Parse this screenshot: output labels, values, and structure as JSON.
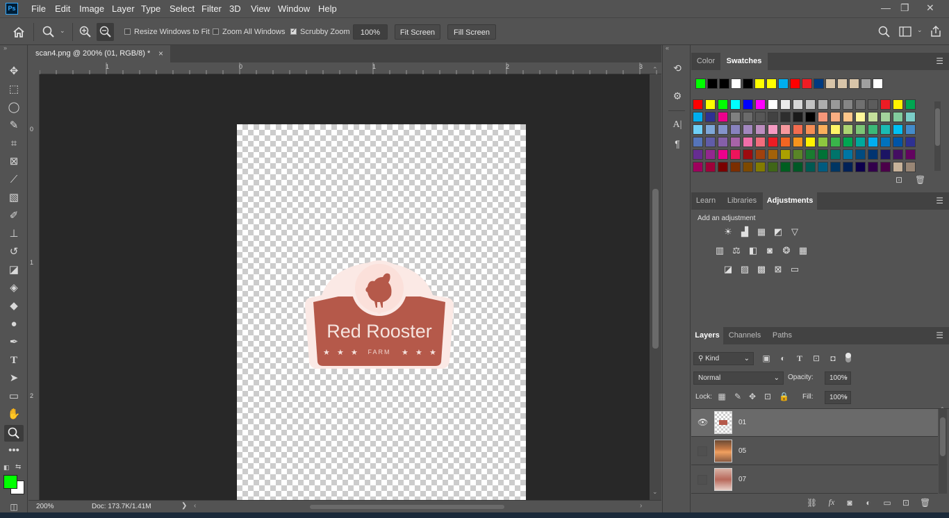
{
  "app": {
    "logo_text": "Ps"
  },
  "menu": [
    "File",
    "Edit",
    "Image",
    "Layer",
    "Type",
    "Select",
    "Filter",
    "3D",
    "View",
    "Window",
    "Help"
  ],
  "window_controls": {
    "minimize": "—",
    "restore": "❐",
    "close": "✕"
  },
  "options_bar": {
    "resize_windows_label": "Resize Windows to Fit",
    "resize_windows_checked": false,
    "zoom_all_label": "Zoom All Windows",
    "zoom_all_checked": false,
    "scrubby_zoom_label": "Scrubby Zoom",
    "scrubby_zoom_checked": true,
    "zoom_value": "100%",
    "fit_screen_label": "Fit Screen",
    "fill_screen_label": "Fill Screen"
  },
  "document": {
    "tab_title": "scan4.png @ 200% (01, RGB/8) *",
    "tab_close": "×",
    "logo_title": "Red Rooster",
    "logo_subtitle": "FARM",
    "logo_color": "#b5594a"
  },
  "rulers": {
    "top_ticks": [
      "1",
      "0",
      "1",
      "2",
      "3"
    ],
    "left_ticks": [
      "0",
      "1",
      "2"
    ]
  },
  "status": {
    "zoom": "200%",
    "doc_info": "Doc: 173.7K/1.41M",
    "arrow": "❯"
  },
  "colors": {
    "foreground": "#00ff00",
    "background": "#ffffff",
    "accent": "#31a8ff"
  },
  "swatches_panel": {
    "tabs": [
      "Color",
      "Swatches"
    ],
    "active_tab": "Swatches",
    "recent": [
      "#00ff00",
      "#000000",
      "#000000",
      "#ffffff",
      "#000000",
      "#ffff00",
      "#ffff00",
      "#00aeef",
      "#ff0000",
      "#ee1d24",
      "#003a80",
      "#d7c4a8",
      "#d7c4a8",
      "#d7c4a8",
      "#a0a0a0",
      "#ffffff"
    ],
    "grid": [
      [
        "#ff0000",
        "#ffff00",
        "#00ff00",
        "#00ffff",
        "#0000ff",
        "#ff00ff",
        "#ffffff",
        "#ebebeb",
        "#d6d6d6",
        "#c2c2c2",
        "#adadad",
        "#999999",
        "#858585",
        "#707070",
        "#5c5c5c",
        "#ed1c24",
        "#fff200",
        "#00a651"
      ],
      [
        "#00aeef",
        "#2e3192",
        "#ec008c",
        "#808080",
        "#6b6b6b",
        "#575757",
        "#424242",
        "#2e2e2e",
        "#1a1a1a",
        "#000000",
        "#f7977a",
        "#f9ad81",
        "#fdc68a",
        "#fff79a",
        "#c4df9b",
        "#a3d39c",
        "#82ca9d",
        "#7bcdc8"
      ],
      [
        "#6ecff6",
        "#7ea7d8",
        "#8493ca",
        "#8882be",
        "#a187be",
        "#bc8dbf",
        "#f49ac2",
        "#f6989d",
        "#f26c4f",
        "#f68e55",
        "#fbaf5c",
        "#fff467",
        "#acd372",
        "#7cc576",
        "#3bb878",
        "#1abbb4",
        "#00bff3",
        "#438ccb"
      ],
      [
        "#5574b9",
        "#605ca8",
        "#855fa8",
        "#a763a8",
        "#f06ea9",
        "#f26d7d",
        "#ed1c24",
        "#f26522",
        "#f7941d",
        "#fff200",
        "#8dc73f",
        "#39b54a",
        "#00a651",
        "#00a99d",
        "#00aeef",
        "#0072bc",
        "#0054a6",
        "#2e3192"
      ],
      [
        "#662d91",
        "#92278f",
        "#ec008c",
        "#ed145b",
        "#9e0b0f",
        "#a0410d",
        "#a36209",
        "#aba000",
        "#598527",
        "#1a7b30",
        "#007236",
        "#00746b",
        "#0076a3",
        "#004b80",
        "#003471",
        "#1b1464",
        "#440e62",
        "#630460"
      ],
      [
        "#9e005d",
        "#9e0039",
        "#790000",
        "#7b2e00",
        "#7d4900",
        "#827b00",
        "#406618",
        "#005e20",
        "#005826",
        "#005952",
        "#005b7f",
        "#003663",
        "#002157",
        "#0d004c",
        "#32004b",
        "#4b0049",
        "#c7b299",
        "#998675"
      ]
    ]
  },
  "adjustments_panel": {
    "tabs": [
      "Learn",
      "Libraries",
      "Adjustments"
    ],
    "active_tab": "Adjustments",
    "heading": "Add an adjustment",
    "row1_icons": [
      "brightness-contrast-icon",
      "levels-icon",
      "curves-icon",
      "exposure-icon",
      "vibrance-icon"
    ],
    "row2_icons": [
      "hue-saturation-icon",
      "color-balance-icon",
      "black-white-icon",
      "photo-filter-icon",
      "channel-mixer-icon",
      "color-lookup-icon"
    ],
    "row3_icons": [
      "invert-icon",
      "posterize-icon",
      "threshold-icon",
      "selective-color-icon",
      "gradient-map-icon"
    ]
  },
  "layers_panel": {
    "tabs": [
      "Layers",
      "Channels",
      "Paths"
    ],
    "active_tab": "Layers",
    "filter_kind": "Kind",
    "blend_mode": "Normal",
    "opacity_label": "Opacity:",
    "opacity_value": "100%",
    "lock_label": "Lock:",
    "fill_label": "Fill:",
    "fill_value": "100%",
    "layers": [
      {
        "name": "01",
        "visible": true,
        "selected": true
      },
      {
        "name": "05",
        "visible": false,
        "selected": false
      },
      {
        "name": "07",
        "visible": false,
        "selected": false
      }
    ]
  }
}
